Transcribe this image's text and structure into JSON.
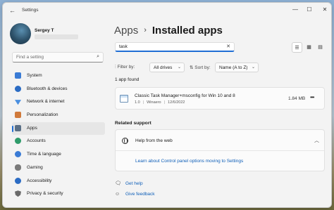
{
  "window": {
    "app_title": "Settings"
  },
  "profile": {
    "name": "Sergey T"
  },
  "sidebar": {
    "search_placeholder": "Find a setting",
    "items": [
      {
        "label": "System",
        "icon": "monitor-icon",
        "color": "#3a7bd5"
      },
      {
        "label": "Bluetooth & devices",
        "icon": "bluetooth-icon",
        "color": "#2b6cc4"
      },
      {
        "label": "Network & internet",
        "icon": "wifi-icon",
        "color": "#4a8fe0"
      },
      {
        "label": "Personalization",
        "icon": "brush-icon",
        "color": "#d07a3b"
      },
      {
        "label": "Apps",
        "icon": "apps-icon",
        "color": "#5a6f86",
        "active": true
      },
      {
        "label": "Accounts",
        "icon": "person-icon",
        "color": "#2f9b6a"
      },
      {
        "label": "Time & language",
        "icon": "clock-globe-icon",
        "color": "#3a7bd5"
      },
      {
        "label": "Gaming",
        "icon": "controller-icon",
        "color": "#7a7a7a"
      },
      {
        "label": "Accessibility",
        "icon": "accessibility-icon",
        "color": "#2b6cc4"
      },
      {
        "label": "Privacy & security",
        "icon": "shield-icon",
        "color": "#6a6a6a"
      }
    ]
  },
  "main": {
    "breadcrumb": {
      "parent": "Apps",
      "separator": "›",
      "current": "Installed apps"
    },
    "search_value": "task",
    "filter": {
      "label": "Filter by:",
      "value": "All drives"
    },
    "sort": {
      "label": "Sort by:",
      "value": "Name (A to Z)"
    },
    "result_count": "1 app found",
    "apps": [
      {
        "name": "Classic Task Manager+msconfig for Win 10 and 8",
        "version": "1.0",
        "publisher": "Winaero",
        "date": "12/6/2022",
        "size": "1.84 MB"
      }
    ],
    "related": {
      "heading": "Related support",
      "help_title": "Help from the web",
      "link": "Learn about Control panel options moving to Settings"
    },
    "footer": {
      "get_help": "Get help",
      "give_feedback": "Give feedback"
    }
  },
  "colors": {
    "accent": "#1f6ed4",
    "link": "#0f5fb8",
    "window_bg": "#f3f3f3"
  }
}
